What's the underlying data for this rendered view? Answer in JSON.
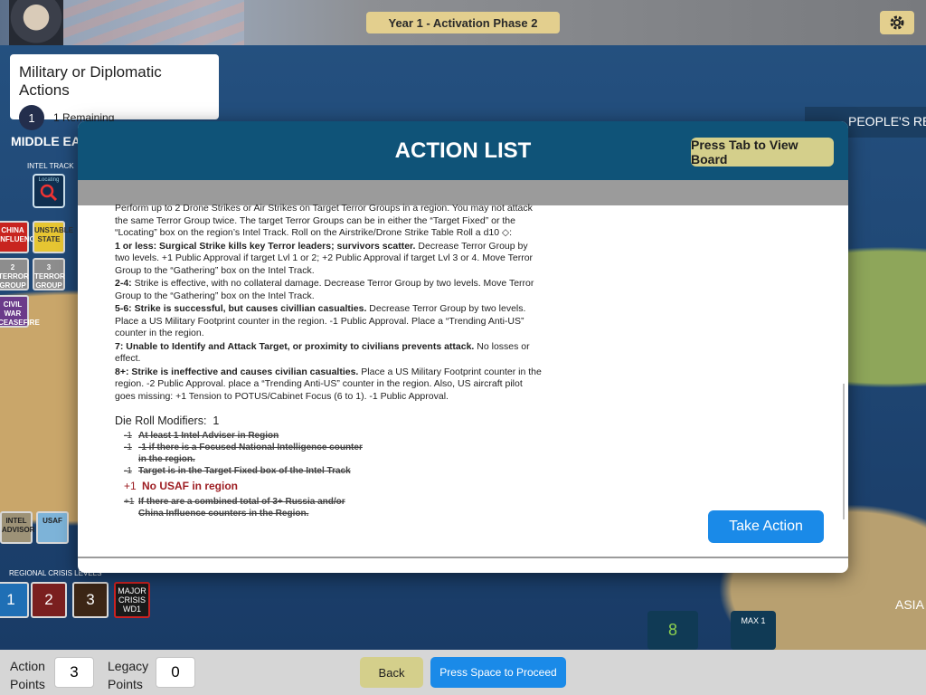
{
  "top_bar": {
    "phase": "Year 1  -  Activation Phase 2"
  },
  "actions_card": {
    "title": "Military or Diplomatic Actions",
    "count": "1",
    "remaining": "1 Remaining"
  },
  "left_board": {
    "region": "MIDDLE EAS",
    "intel_track": "INTEL TRACK",
    "locating": "Locating",
    "tiles": [
      "CHINA INFLUENCE",
      "UNSTABLE STATE",
      "2 TERROR GROUP",
      "3 TERROR GROUP",
      "CIVIL WAR CEASEFIRE"
    ],
    "crisis_label": "REGIONAL CRISIS LEVELS",
    "crisis_levels": [
      "1",
      "2",
      "3",
      "MAJOR CRISIS WD1"
    ],
    "advisor": "INTEL ADVISOR",
    "usaf": "USAF"
  },
  "right_board": {
    "header": "PEOPLE'S REP",
    "asia": "ASIA",
    "bottom_value": "8",
    "max_label": "MAX 1"
  },
  "modal": {
    "title": "ACTION LIST",
    "tab_button": "Press Tab to View Board",
    "intro": "Perform up to 2 Drone Strikes or Air Strikes on Target Terror Groups in a region. You may not attack the same Terror Group twice. The target Terror Groups can be in either the “Target Fixed” or the “Locating” box on the region’s Intel Track. Roll on the Airstrike/Drone Strike Table Roll a d10",
    "results": [
      {
        "head": "1 or less: Surgical Strike kills key Terror leaders; survivors scatter.",
        "body": " Decrease Terror Group by two levels. +1 Public Approval if target Lvl 1 or 2; +2 Public Approval if target Lvl 3 or 4. Move Terror Group to the “Gathering” box on the Intel Track."
      },
      {
        "head": "2-4:",
        "body": " Strike is effective, with no collateral damage. Decrease Terror Group by two levels. Move Terror Group to the “Gathering” box on the Intel Track."
      },
      {
        "head": "5-6: Strike is successful, but causes civillian casualties.",
        "body": "  Decrease Terror Group by two levels. Place a US Military Footprint counter in the region. -1 Public Approval. Place a “Trending Anti-US” counter in the region."
      },
      {
        "head": "7: Unable to Identify and Attack Target, or proximity to civilians prevents attack.",
        "body": "  No losses or effect."
      },
      {
        "head": "8+: Strike is ineffective and causes civilian casualties.",
        "body": "  Place a US Military Footprint counter in the region. -2 Public Approval. place a “Trending Anti-US” counter in the region. Also, US aircraft pilot goes missing: +1 Tension to POTUS/Cabinet Focus (6 to 1). -1 Public Approval."
      }
    ],
    "modifiers_label": "Die Roll Modifiers:",
    "modifiers_total": "1",
    "modifiers": [
      {
        "value": "-1",
        "text": "At least 1 Intel Adviser in Region",
        "active": false
      },
      {
        "value": "-1",
        "text": "-1 if there is a Focused National Intelligence counter in the region.",
        "active": false
      },
      {
        "value": "-1",
        "text": "Target is in the Target Fixed box of the Intel Track",
        "active": false
      },
      {
        "value": "+1",
        "text": "No USAF in region",
        "active": true
      },
      {
        "value": "+1",
        "text": "If there are a combined total of 3+ Russia and/or China Influence counters in the Region.",
        "active": false
      }
    ],
    "take_action": "Take Action"
  },
  "bottom_bar": {
    "action_label": "Action Points",
    "action_value": "3",
    "legacy_label": "Legacy Points",
    "legacy_value": "0",
    "back": "Back",
    "proceed": "Press Space to Proceed"
  },
  "colors": {
    "header_blue": "#0f5378",
    "button_gold": "#d4cf8b",
    "button_blue": "#1a8ae8",
    "active_modifier": "#9d1d22"
  }
}
